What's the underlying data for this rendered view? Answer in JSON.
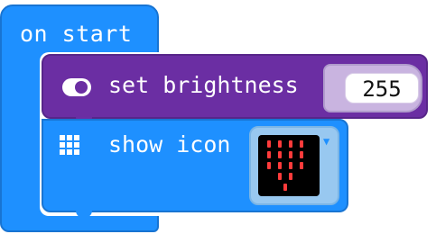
{
  "blocks": {
    "on_start": {
      "label": "on start",
      "color": "#1e90ff"
    },
    "set_brightness": {
      "label": "set brightness",
      "value": "255",
      "color": "#6b2ea3",
      "icon": "toggle-icon"
    },
    "show_icon": {
      "label": "show icon",
      "color": "#1e90ff",
      "icon": "grid-icon",
      "selected_icon": "heart"
    }
  }
}
